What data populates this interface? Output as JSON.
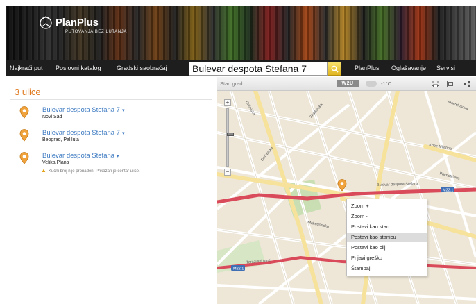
{
  "header": {
    "logo_name": "PlanPlus",
    "logo_tagline": "PUTOVANJA BEZ LUTANJA"
  },
  "nav": {
    "items_left": [
      "Najkraći put",
      "Poslovni katalog",
      "Gradski saobraćaj"
    ],
    "search_value": "Bulevar despota Stefana 7",
    "items_right": [
      "PlanPlus",
      "Oglašavanje",
      "Servisi"
    ]
  },
  "results": {
    "count_title": "3 ulice",
    "items": [
      {
        "name": "Bulevar despota Stefana 7",
        "place": "Novi Sad"
      },
      {
        "name": "Bulevar despota Stefana 7",
        "place": "Beograd, Palilula"
      },
      {
        "name": "Bulevar despota Stefana",
        "place": "Velika Plana",
        "warning": "Kućni broj nije pronađen. Prikazan je centar ulice."
      }
    ]
  },
  "map_toolbar": {
    "district": "Stari grad",
    "weather_logo": "W2U",
    "temperature": "-1°C"
  },
  "map": {
    "zoom_in": "+",
    "zoom_out": "−",
    "labels": [
      "Cetinjska",
      "Skadarska",
      "Knez Miletina",
      "Dečanska",
      "Makedonska",
      "Terazijski tunel",
      "Bulevar despota Stefana",
      "Venizelosova",
      "Palmotićeva"
    ],
    "route_badges": [
      "M22.1",
      "M22.1"
    ]
  },
  "context_menu": {
    "items": [
      "Zoom +",
      "Zoom -",
      "Postavi kao start",
      "Postavi kao stanicu",
      "Postavi kao cilj",
      "Prijavi grešku",
      "Štampaj"
    ],
    "highlighted_index": 3
  },
  "colors": {
    "accent_orange": "#e0781e",
    "link_blue": "#3e7bc2",
    "route_red": "#d43a4a",
    "nav_bg": "#1e1e1e",
    "search_button_yellow": "#f0c83a"
  }
}
